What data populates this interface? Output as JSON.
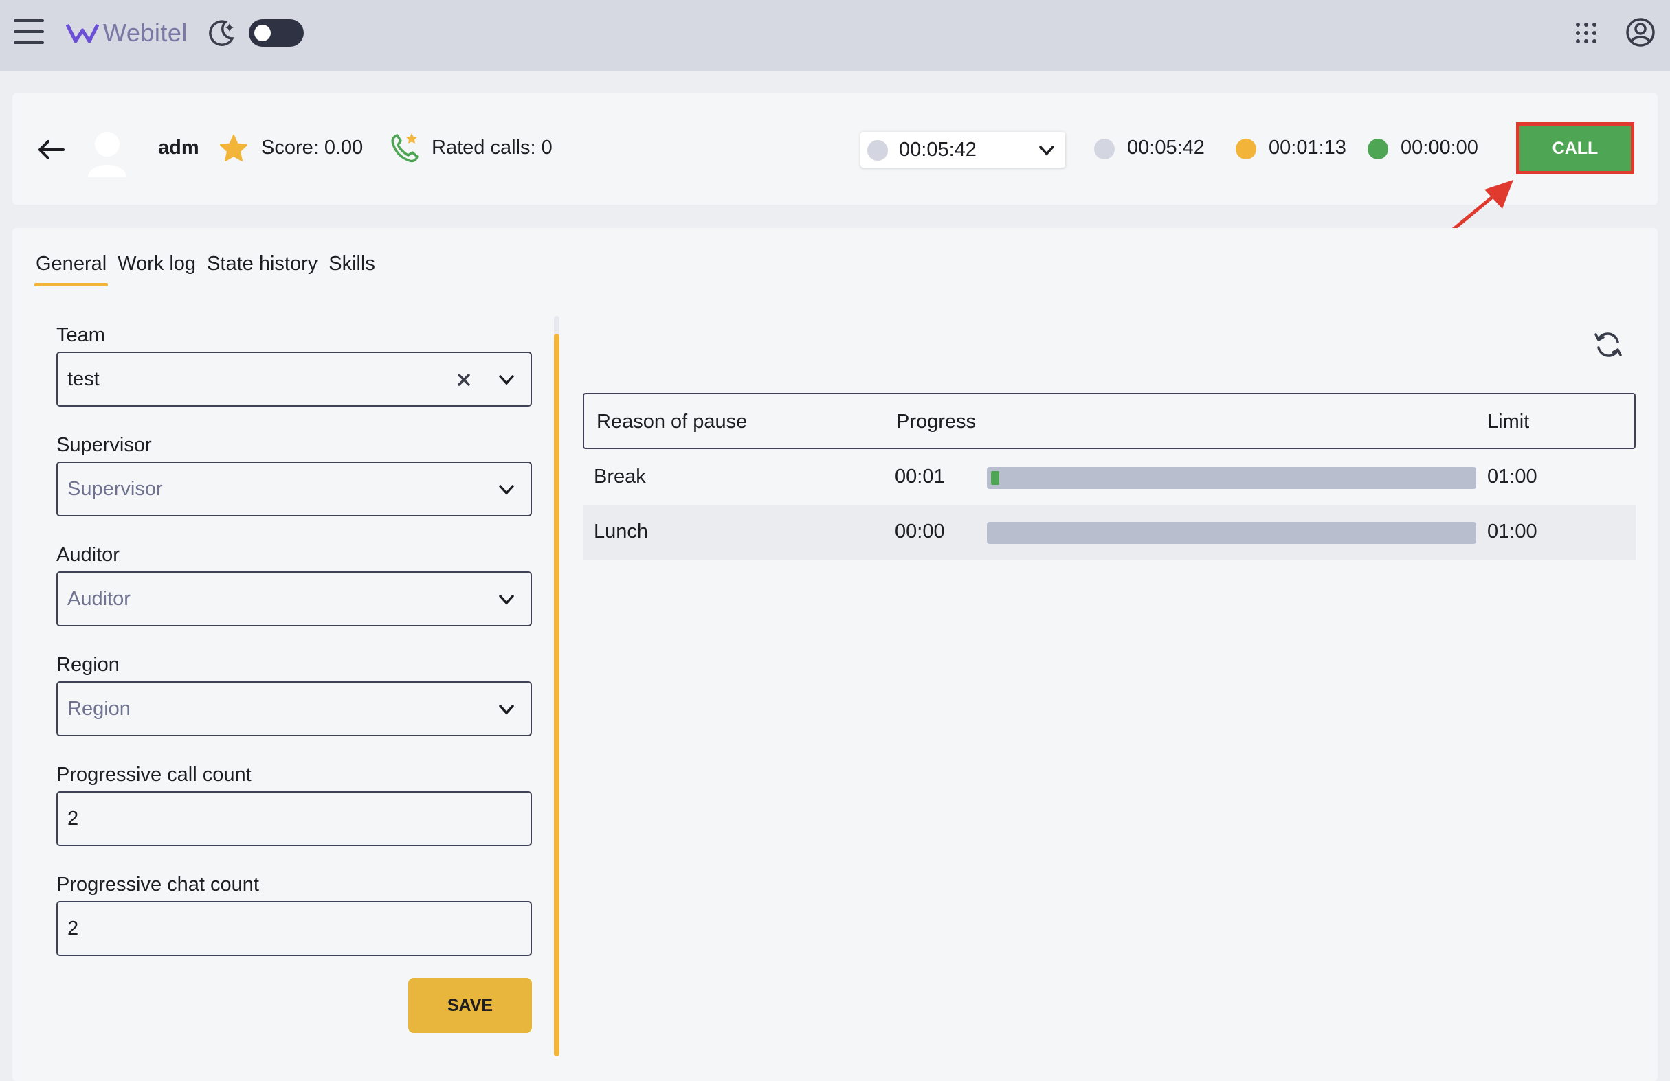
{
  "app": {
    "logo_text": "Webitel"
  },
  "agent": {
    "name": "adm",
    "score": "Score: 0.00",
    "rated_calls": "Rated calls: 0"
  },
  "status": {
    "selected_time": "00:05:42",
    "timers": [
      {
        "value": "00:05:42",
        "color": "#d3d5e0"
      },
      {
        "value": "00:01:13",
        "color": "#f2b53a"
      },
      {
        "value": "00:00:00",
        "color": "#4ea654"
      }
    ],
    "call_label": "CALL"
  },
  "tabs": [
    "General",
    "Work log",
    "State history",
    "Skills"
  ],
  "form": {
    "team": {
      "label": "Team",
      "value": "test"
    },
    "supervisor": {
      "label": "Supervisor",
      "placeholder": "Supervisor"
    },
    "auditor": {
      "label": "Auditor",
      "placeholder": "Auditor"
    },
    "region": {
      "label": "Region",
      "placeholder": "Region"
    },
    "progressive_call_count": {
      "label": "Progressive call count",
      "value": "2"
    },
    "progressive_chat_count": {
      "label": "Progressive chat count",
      "value": "2"
    },
    "save_label": "SAVE"
  },
  "pause_table": {
    "headers": {
      "reason": "Reason of pause",
      "progress": "Progress",
      "limit": "Limit"
    },
    "rows": [
      {
        "reason": "Break",
        "time": "00:01",
        "limit": "01:00",
        "progress_fraction": 0.0167
      },
      {
        "reason": "Lunch",
        "time": "00:00",
        "limit": "01:00",
        "progress_fraction": 0
      }
    ]
  },
  "colors": {
    "accent": "#f2b53a",
    "call_button": "#4ea654",
    "annotation": "#e03a2e"
  }
}
